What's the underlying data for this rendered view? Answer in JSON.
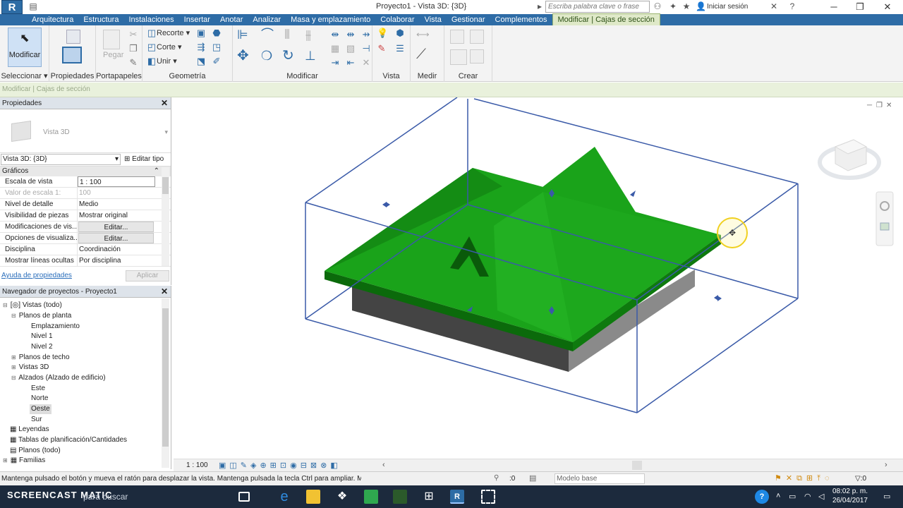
{
  "app": {
    "logo_letter": "R",
    "title": "Proyecto1 - Vista 3D: {3D}",
    "search_placeholder": "Escriba palabra clave o frase",
    "signin": "Iniciar sesión"
  },
  "menu": [
    "Arquitectura",
    "Estructura",
    "Instalaciones",
    "Insertar",
    "Anotar",
    "Analizar",
    "Masa y emplazamiento",
    "Colaborar",
    "Vista",
    "Gestionar",
    "Complementos",
    "Modificar | Cajas de sección"
  ],
  "ribbon": {
    "modify_label": "Modificar",
    "paste_label": "Pegar",
    "cope_label": "Recorte",
    "cut_label": "Corte",
    "join_label": "Unir",
    "groups": [
      "Seleccionar ▾",
      "Propiedades",
      "Portapapeles",
      "Geometría",
      "Modificar",
      "Vista",
      "Medir",
      "Crear"
    ]
  },
  "context_bar": "Modificar | Cajas de sección",
  "properties": {
    "header": "Propiedades",
    "type_name": "Vista 3D",
    "selector": "Vista 3D: {3D}",
    "edit_type": "Editar tipo",
    "group": "Gráficos",
    "rows": [
      {
        "k": "Escala de vista",
        "v": "1 : 100"
      },
      {
        "k": "Valor de escala    1:",
        "v": "100"
      },
      {
        "k": "Nivel de detalle",
        "v": "Medio"
      },
      {
        "k": "Visibilidad de piezas",
        "v": "Mostrar original"
      },
      {
        "k": "Modificaciones de vis...",
        "v": "Editar..."
      },
      {
        "k": "Opciones de visualiza...",
        "v": "Editar..."
      },
      {
        "k": "Disciplina",
        "v": "Coordinación"
      },
      {
        "k": "Mostrar líneas ocultas",
        "v": "Por disciplina"
      }
    ],
    "help_link": "Ayuda de propiedades",
    "apply": "Aplicar"
  },
  "browser": {
    "header": "Navegador de proyectos - Proyecto1",
    "nodes": [
      {
        "label": "Vistas (todo)",
        "toggle": "⊟"
      },
      {
        "label": "Planos de planta",
        "toggle": "⊟"
      },
      {
        "label": "Emplazamiento",
        "toggle": ""
      },
      {
        "label": "Nivel 1",
        "toggle": ""
      },
      {
        "label": "Nivel 2",
        "toggle": ""
      },
      {
        "label": "Planos de techo",
        "toggle": "⊞"
      },
      {
        "label": "Vistas 3D",
        "toggle": "⊞"
      },
      {
        "label": "Alzados (Alzado de edificio)",
        "toggle": "⊟"
      },
      {
        "label": "Este",
        "toggle": ""
      },
      {
        "label": "Norte",
        "toggle": ""
      },
      {
        "label": "Oeste",
        "toggle": ""
      },
      {
        "label": "Sur",
        "toggle": ""
      },
      {
        "label": "Leyendas",
        "toggle": ""
      },
      {
        "label": "Tablas de planificación/Cantidades",
        "toggle": ""
      },
      {
        "label": "Planos (todo)",
        "toggle": ""
      },
      {
        "label": "Familias",
        "toggle": "⊞"
      }
    ]
  },
  "viewbar": {
    "scale": "1 : 100"
  },
  "status": {
    "message": "Mantenga pulsado el botón y mueva el ratón para desplazar la vista. Mantenga pulsada la tecla Ctrl para ampliar. M",
    "zero": ":0",
    "model": "Modelo base",
    "filter": ":0"
  },
  "taskbar": {
    "brand": "SCREENCAST  MATIC",
    "search": "para buscar",
    "time": "08:02 p. m.",
    "date": "26/04/2017"
  },
  "colors": {
    "roof": "#1aa31a",
    "roof_dark": "#0e7a0e",
    "walls": "#444444",
    "section_box": "#3a5aa8",
    "ribbon_blue": "#2e6ca6"
  }
}
